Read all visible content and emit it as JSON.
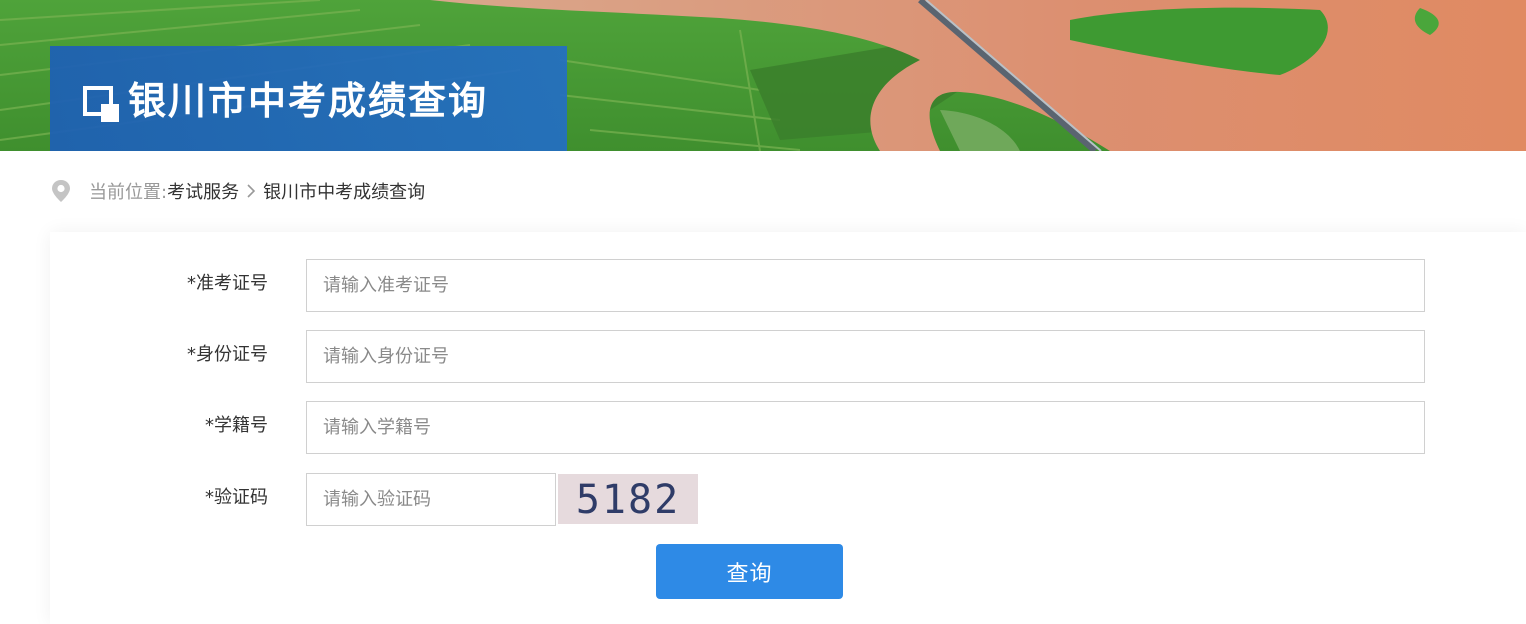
{
  "header": {
    "title": "银川市中考成绩查询"
  },
  "breadcrumb": {
    "prefix": "当前位置:",
    "parent": "考试服务",
    "current": "银川市中考成绩查询"
  },
  "form": {
    "fields": [
      {
        "label": "*准考证号",
        "placeholder": "请输入准考证号",
        "value": ""
      },
      {
        "label": "*身份证号",
        "placeholder": "请输入身份证号",
        "value": ""
      },
      {
        "label": "*学籍号",
        "placeholder": "请输入学籍号",
        "value": ""
      },
      {
        "label": "*验证码",
        "placeholder": "请输入验证码",
        "value": ""
      }
    ],
    "captcha_text": "5182",
    "submit_label": "查询"
  },
  "colors": {
    "title_box": "#1f62b4",
    "button": "#2e8ae6",
    "captcha_bg": "#e6dadd",
    "river": "#d98a6e",
    "field_green": "#4fa33a"
  },
  "icons": {
    "title": "window-square-icon",
    "location": "map-pin-icon",
    "separator": "chevron-right-icon"
  }
}
